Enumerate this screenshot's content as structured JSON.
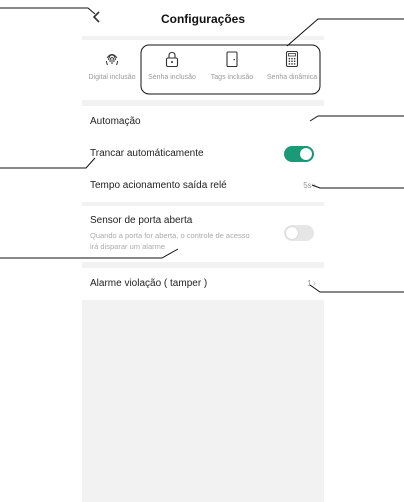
{
  "header": {
    "title": "Configurações",
    "back_icon": "chevron-left-icon"
  },
  "modes": [
    {
      "label": "Digital inclusão",
      "icon": "fingerprint-icon"
    },
    {
      "label": "Senha inclusão",
      "icon": "lock-icon"
    },
    {
      "label": "Tags inclusão",
      "icon": "door-icon"
    },
    {
      "label": "Senha dinâmica",
      "icon": "keypad-icon"
    }
  ],
  "settings": {
    "automation": {
      "label": "Automação"
    },
    "auto_lock": {
      "label": "Trancar automáticamente",
      "enabled": true
    },
    "relay_time": {
      "label": "Tempo acionamento saída relé",
      "value": "5s"
    },
    "door_sensor": {
      "label": "Sensor de porta aberta",
      "description": "Quando a porta for aberta, o controle de acesso irá disparar um alarme",
      "enabled": false
    },
    "tamper_alarm": {
      "label": "Alarme violação ( tamper )",
      "value": "1"
    }
  },
  "colors": {
    "toggle_on": "#1a9a77",
    "toggle_off": "#e6e6e6",
    "page_bg": "#f2f2f2"
  }
}
